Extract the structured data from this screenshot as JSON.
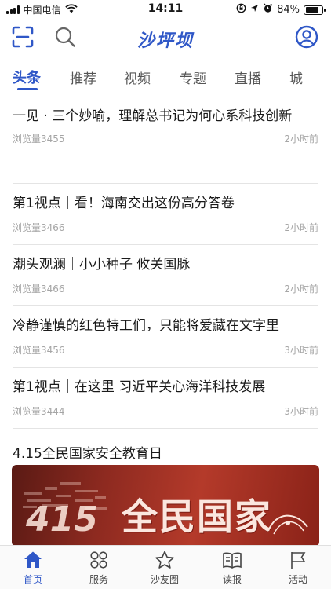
{
  "status_bar": {
    "carrier": "中国电信",
    "time": "14:11",
    "battery": "84%",
    "battery_level": 0.84
  },
  "header": {
    "logo": "沙坪坝"
  },
  "tabs": [
    {
      "label": "头条",
      "active": true
    },
    {
      "label": "推荐",
      "active": false
    },
    {
      "label": "视频",
      "active": false
    },
    {
      "label": "专题",
      "active": false
    },
    {
      "label": "直播",
      "active": false
    },
    {
      "label": "城",
      "active": false
    }
  ],
  "news": [
    {
      "title": "一见 · 三个妙喻，理解总书记为何心系科技创新",
      "views": "浏览量3455",
      "time": "2小时前"
    },
    {
      "title": "第1视点｜看！海南交出这份高分答卷",
      "views": "浏览量3466",
      "time": "2小时前"
    },
    {
      "title": "潮头观澜｜小小种子 攸关国脉",
      "views": "浏览量3466",
      "time": "2小时前"
    },
    {
      "title": "冷静谨慎的红色特工们，只能将爱藏在文字里",
      "views": "浏览量3456",
      "time": "3小时前"
    },
    {
      "title": "第1视点｜在这里 习近平关心海洋科技发展",
      "views": "浏览量3444",
      "time": "3小时前"
    }
  ],
  "feature": {
    "title": "4.15全民国家安全教育日",
    "banner_big": "415",
    "banner_text": "全民国家"
  },
  "tabbar": [
    {
      "label": "首页",
      "icon": "home-icon",
      "active": true
    },
    {
      "label": "服务",
      "icon": "grid-icon",
      "active": false
    },
    {
      "label": "沙友圈",
      "icon": "star-icon",
      "active": false
    },
    {
      "label": "读报",
      "icon": "book-icon",
      "active": false
    },
    {
      "label": "活动",
      "icon": "flag-icon",
      "active": false
    }
  ],
  "colors": {
    "accent": "#2f57c7",
    "meta_text": "#a5a5a5"
  }
}
